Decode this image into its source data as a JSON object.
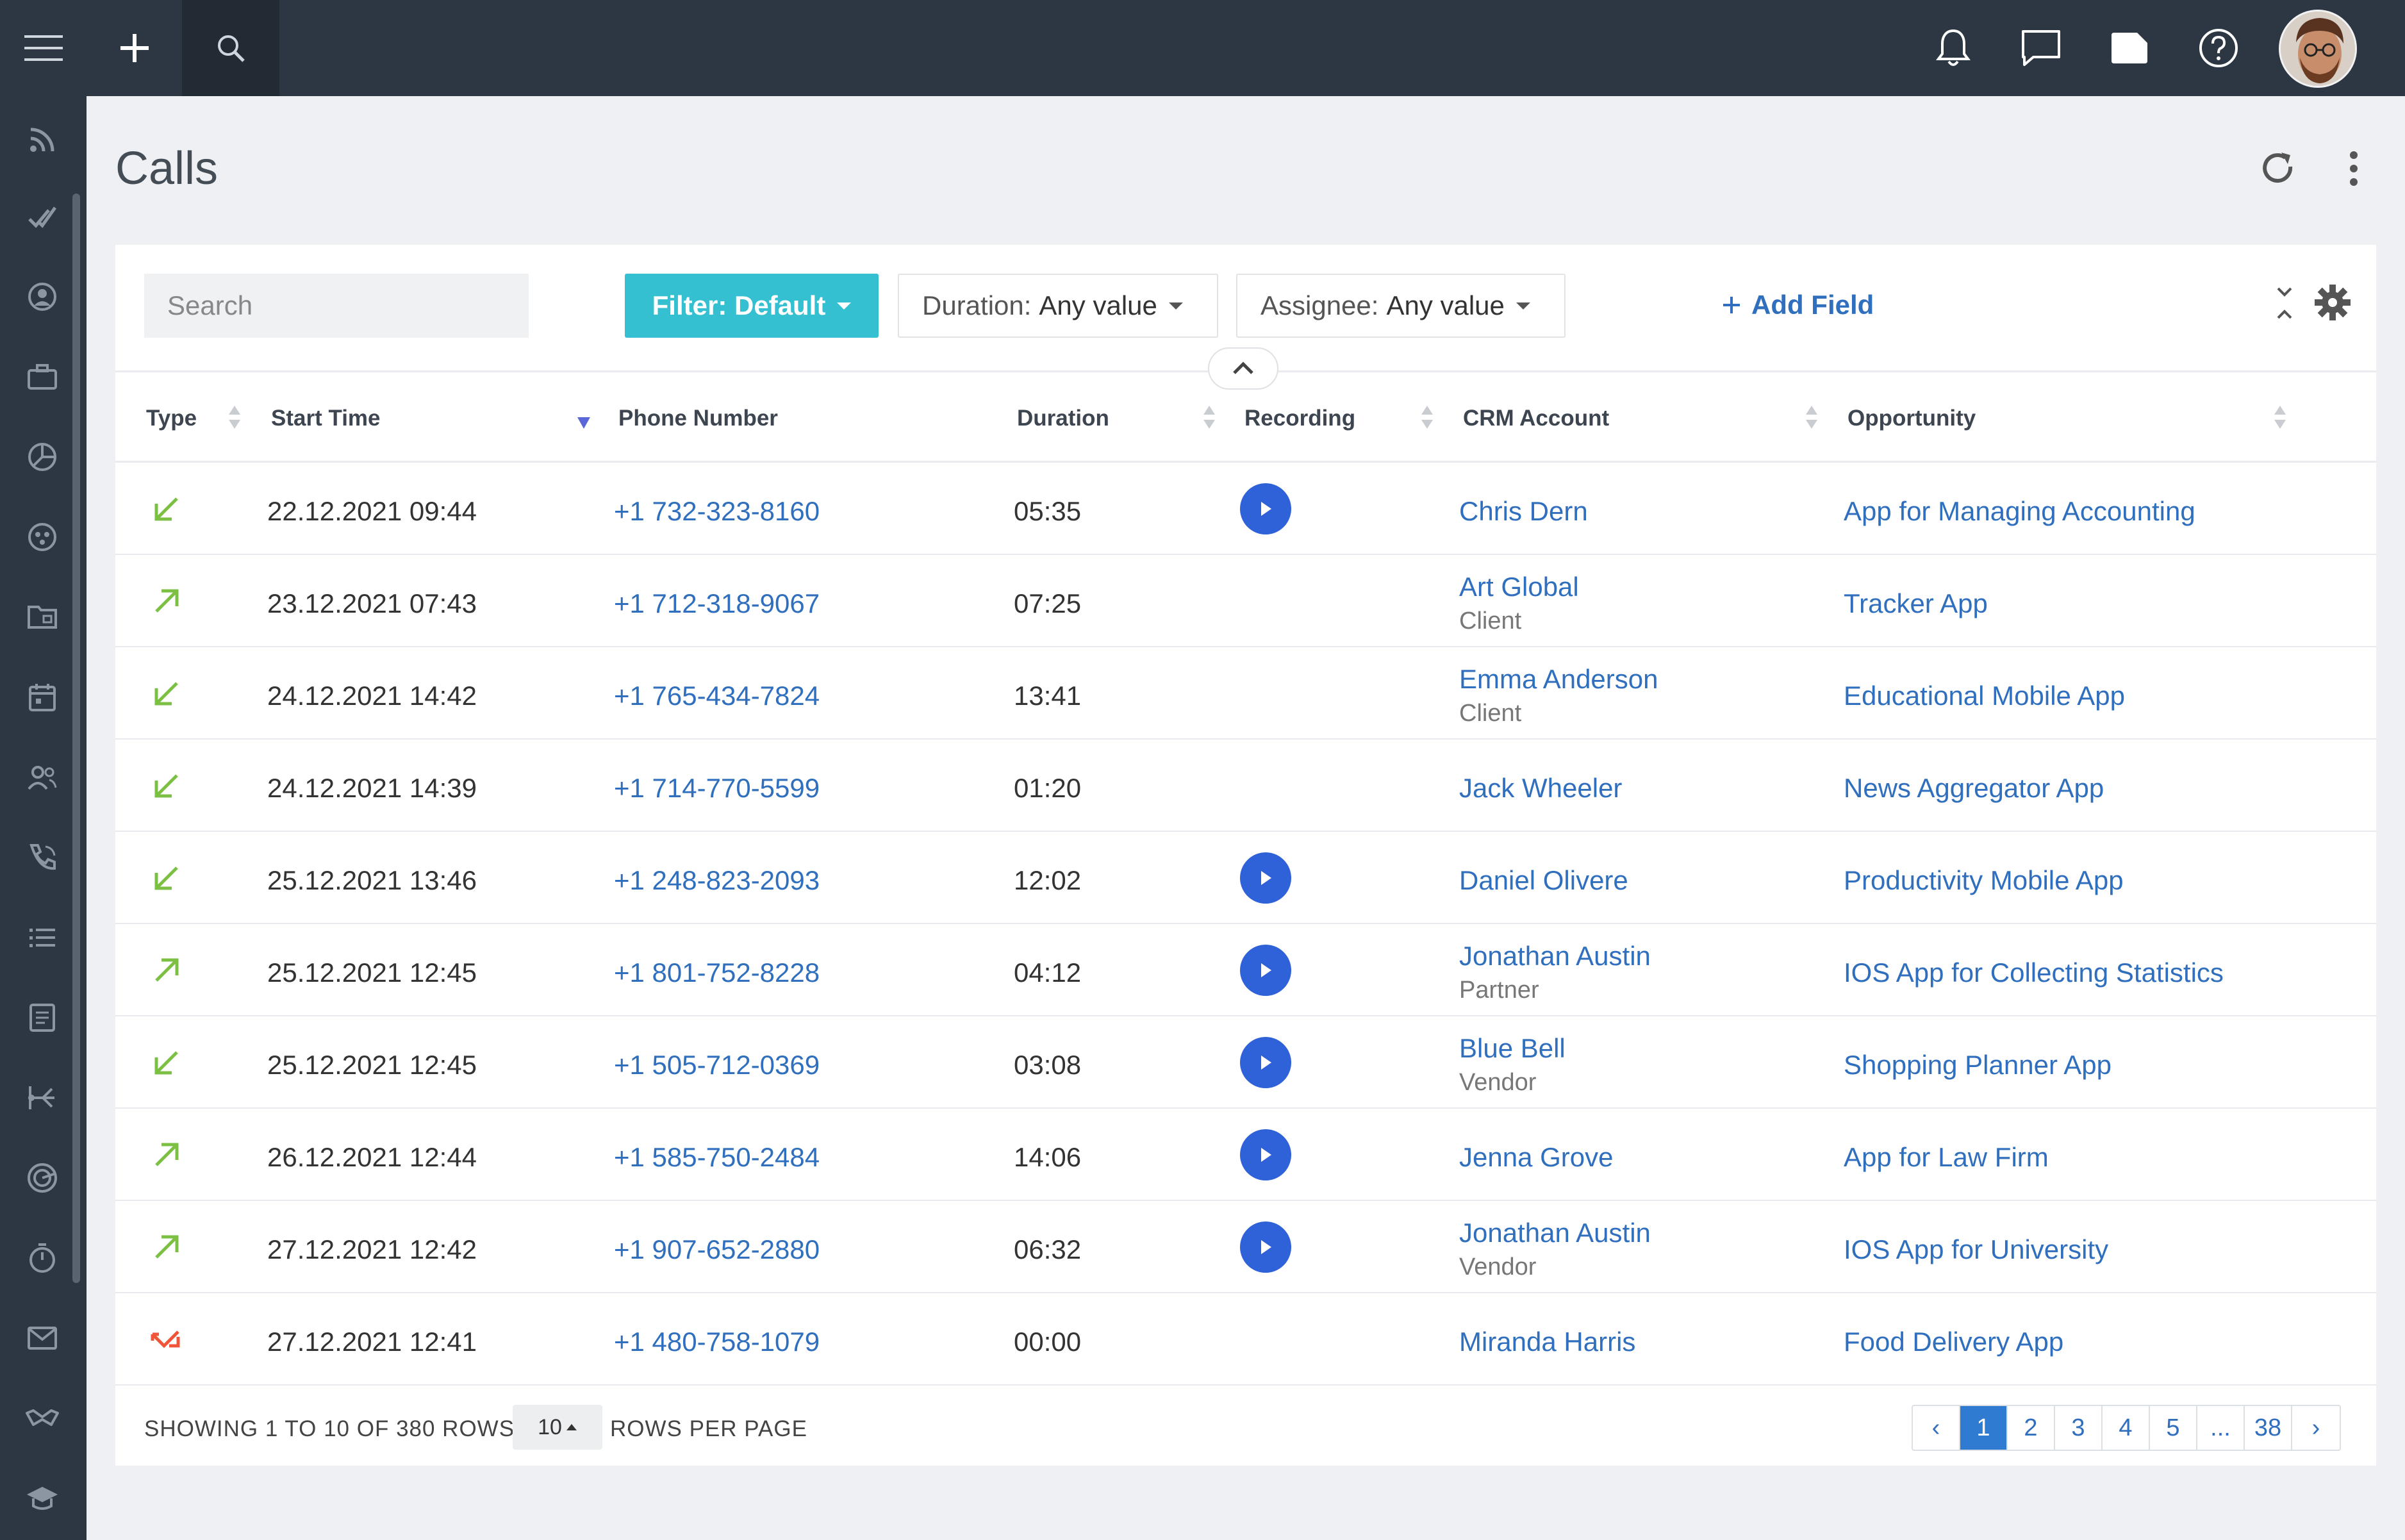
{
  "page": {
    "title": "Calls"
  },
  "toolbar": {
    "search_placeholder": "Search",
    "filter_label": "Filter: Default",
    "duration_key": "Duration:",
    "duration_value": "Any value",
    "assignee_key": "Assignee:",
    "assignee_value": "Any value",
    "add_field_label": "Add Field"
  },
  "table": {
    "columns": [
      "Type",
      "Start Time",
      "Phone Number",
      "Duration",
      "Recording",
      "CRM Account",
      "Opportunity"
    ],
    "rows": [
      {
        "type": "incoming",
        "time": "22.12.2021 09:44",
        "phone": "+1 732-323-8160",
        "duration": "05:35",
        "recording": true,
        "crm": "Chris Dern",
        "crm_sub": "",
        "opp": "App for Managing Accounting"
      },
      {
        "type": "outgoing",
        "time": "23.12.2021 07:43",
        "phone": "+1 712-318-9067",
        "duration": "07:25",
        "recording": false,
        "crm": "Art Global",
        "crm_sub": "Client",
        "opp": "Tracker App"
      },
      {
        "type": "incoming",
        "time": "24.12.2021 14:42",
        "phone": "+1 765-434-7824",
        "duration": "13:41",
        "recording": false,
        "crm": "Emma Anderson",
        "crm_sub": "Client",
        "opp": "Educational Mobile App"
      },
      {
        "type": "incoming",
        "time": "24.12.2021 14:39",
        "phone": "+1 714-770-5599",
        "duration": "01:20",
        "recording": false,
        "crm": "Jack Wheeler",
        "crm_sub": "",
        "opp": "News Aggregator App"
      },
      {
        "type": "incoming",
        "time": "25.12.2021 13:46",
        "phone": "+1 248-823-2093",
        "duration": "12:02",
        "recording": true,
        "crm": "Daniel Olivere",
        "crm_sub": "",
        "opp": "Productivity Mobile App"
      },
      {
        "type": "outgoing",
        "time": "25.12.2021 12:45",
        "phone": "+1 801-752-8228",
        "duration": "04:12",
        "recording": true,
        "crm": "Jonathan Austin",
        "crm_sub": "Partner",
        "opp": "IOS App for Collecting Statistics"
      },
      {
        "type": "incoming",
        "time": "25.12.2021 12:45",
        "phone": "+1 505-712-0369",
        "duration": "03:08",
        "recording": true,
        "crm": "Blue Bell",
        "crm_sub": "Vendor",
        "opp": "Shopping Planner App"
      },
      {
        "type": "outgoing",
        "time": "26.12.2021 12:44",
        "phone": "+1 585-750-2484",
        "duration": "14:06",
        "recording": true,
        "crm": "Jenna Grove",
        "crm_sub": "",
        "opp": "App for Law Firm"
      },
      {
        "type": "outgoing",
        "time": "27.12.2021 12:42",
        "phone": "+1 907-652-2880",
        "duration": "06:32",
        "recording": true,
        "crm": "Jonathan Austin",
        "crm_sub": "Vendor",
        "opp": "IOS App for University"
      },
      {
        "type": "missed",
        "time": "27.12.2021 12:41",
        "phone": "+1 480-758-1079",
        "duration": "00:00",
        "recording": false,
        "crm": "Miranda Harris",
        "crm_sub": "",
        "opp": "Food Delivery App"
      }
    ]
  },
  "footer": {
    "showing": "SHOWING 1 TO 10 OF 380 ROWS",
    "rows_per_page_value": "10",
    "rows_per_page_label": "ROWS PER PAGE",
    "pages": [
      "‹",
      "1",
      "2",
      "3",
      "4",
      "5",
      "...",
      "38",
      "›"
    ],
    "current_page": "1"
  },
  "colors": {
    "topbar": "#2d3744",
    "accent": "#35c0d1",
    "link": "#2f6fbe",
    "incoming": "#7cc043",
    "outgoing": "#7cc043",
    "missed": "#f0553a",
    "play": "#2f62d8"
  },
  "icons": {
    "topbar": [
      "menu-icon",
      "plus-icon",
      "search-icon",
      "bell-icon",
      "chat-icon",
      "tag-icon",
      "help-icon"
    ],
    "sidebar": [
      "feed-icon",
      "tasks-icon",
      "contacts-icon",
      "briefcase-icon",
      "chart-icon",
      "support-icon",
      "folder-icon",
      "calendar-icon",
      "team-icon",
      "calls-icon",
      "list-icon",
      "document-icon",
      "workflow-icon",
      "target-icon",
      "timer-icon",
      "mail-icon",
      "deals-icon",
      "education-icon"
    ]
  }
}
